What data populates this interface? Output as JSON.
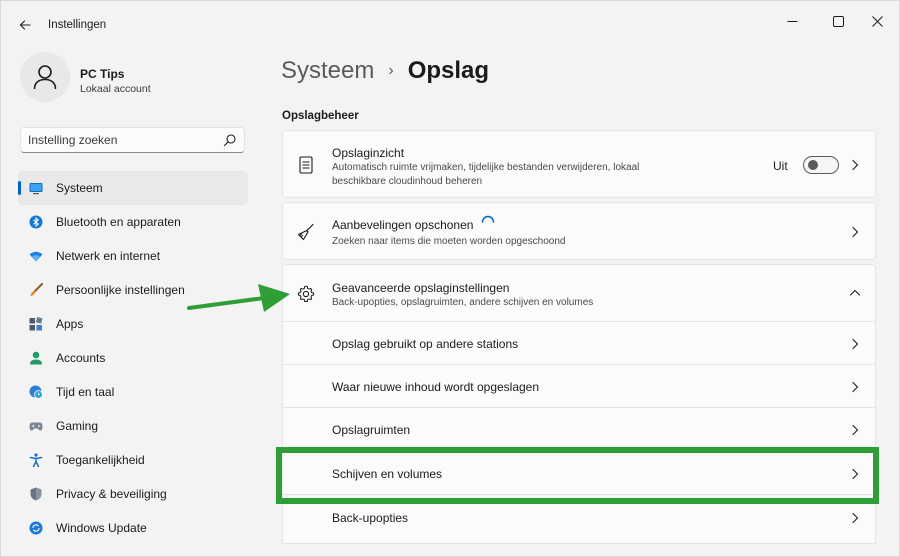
{
  "window": {
    "title": "Instellingen"
  },
  "user": {
    "name": "PC Tips",
    "account_type": "Lokaal account"
  },
  "search": {
    "placeholder": "Instelling zoeken",
    "value": ""
  },
  "sidebar": {
    "items": [
      {
        "label": "Systeem",
        "icon": "monitor-icon",
        "selected": true
      },
      {
        "label": "Bluetooth en apparaten",
        "icon": "bluetooth-icon",
        "selected": false
      },
      {
        "label": "Netwerk en internet",
        "icon": "wifi-icon",
        "selected": false
      },
      {
        "label": "Persoonlijke instellingen",
        "icon": "brush-icon",
        "selected": false
      },
      {
        "label": "Apps",
        "icon": "apps-icon",
        "selected": false
      },
      {
        "label": "Accounts",
        "icon": "person-icon",
        "selected": false
      },
      {
        "label": "Tijd en taal",
        "icon": "globe-clock-icon",
        "selected": false
      },
      {
        "label": "Gaming",
        "icon": "gamepad-icon",
        "selected": false
      },
      {
        "label": "Toegankelijkheid",
        "icon": "accessibility-icon",
        "selected": false
      },
      {
        "label": "Privacy & beveiliging",
        "icon": "shield-icon",
        "selected": false
      },
      {
        "label": "Windows Update",
        "icon": "update-icon",
        "selected": false
      }
    ]
  },
  "breadcrumb": {
    "parent": "Systeem",
    "separator": "›",
    "current": "Opslag"
  },
  "section": {
    "title": "Opslagbeheer"
  },
  "cards": {
    "storage_sense": {
      "title": "Opslaginzicht",
      "description": "Automatisch ruimte vrijmaken, tijdelijke bestanden verwijderen, lokaal beschikbare cloudinhoud beheren",
      "toggle_label": "Uit",
      "toggle_on": false
    },
    "cleanup": {
      "title": "Aanbevelingen opschonen",
      "description": "Zoeken naar items die moeten worden opgeschoond"
    },
    "advanced": {
      "title": "Geavanceerde opslaginstellingen",
      "description": "Back-upopties, opslagruimten, andere schijven en volumes",
      "expanded": true
    }
  },
  "sub_rows": [
    {
      "label": "Opslag gebruikt op andere stations"
    },
    {
      "label": "Waar nieuwe inhoud wordt opgeslagen"
    },
    {
      "label": "Opslagruimten"
    },
    {
      "label": "Schijven en volumes",
      "highlighted": true
    },
    {
      "label": "Back-upopties"
    }
  ],
  "colors": {
    "accent": "#0067c0",
    "highlight_green": "#2f9e37",
    "window_bg": "#f3f3f3",
    "card_bg": "#fbfbfb"
  }
}
